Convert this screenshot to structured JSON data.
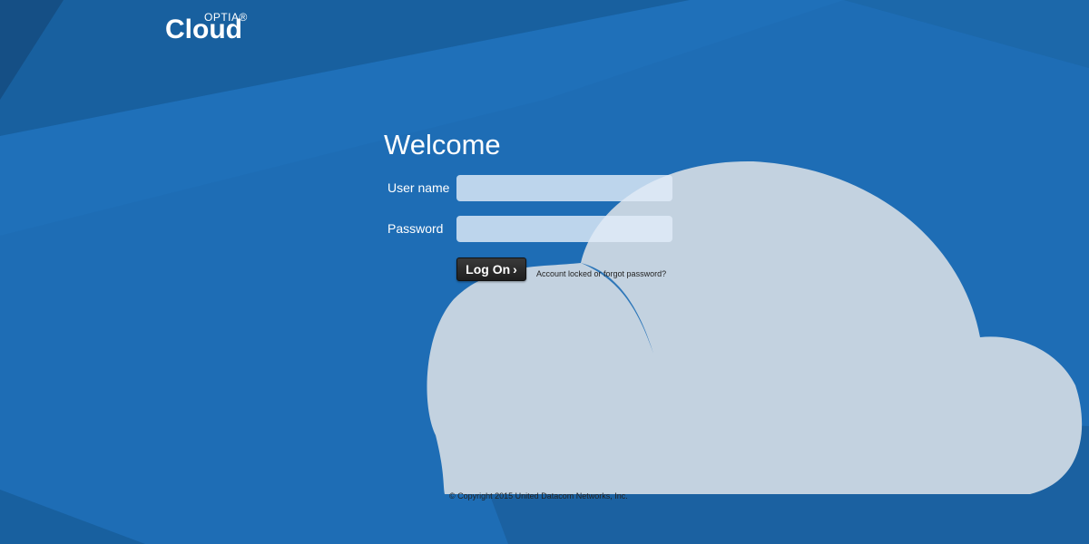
{
  "logo": {
    "brand_small": "OPTIA®",
    "brand_large": "Cloud"
  },
  "login": {
    "heading": "Welcome",
    "username_label": "User name",
    "username_value": "",
    "password_label": "Password",
    "password_value": "",
    "logon_label": "Log On",
    "logon_icon": "chevron-right-icon",
    "forgot_link": "Account locked or forgot password?"
  },
  "footer": {
    "copyright": "© Copyright 2015 United Datacom Networks, Inc."
  },
  "colors": {
    "background": "#1e6db5",
    "cloud": "#c3d2e0",
    "button": "#262626"
  }
}
